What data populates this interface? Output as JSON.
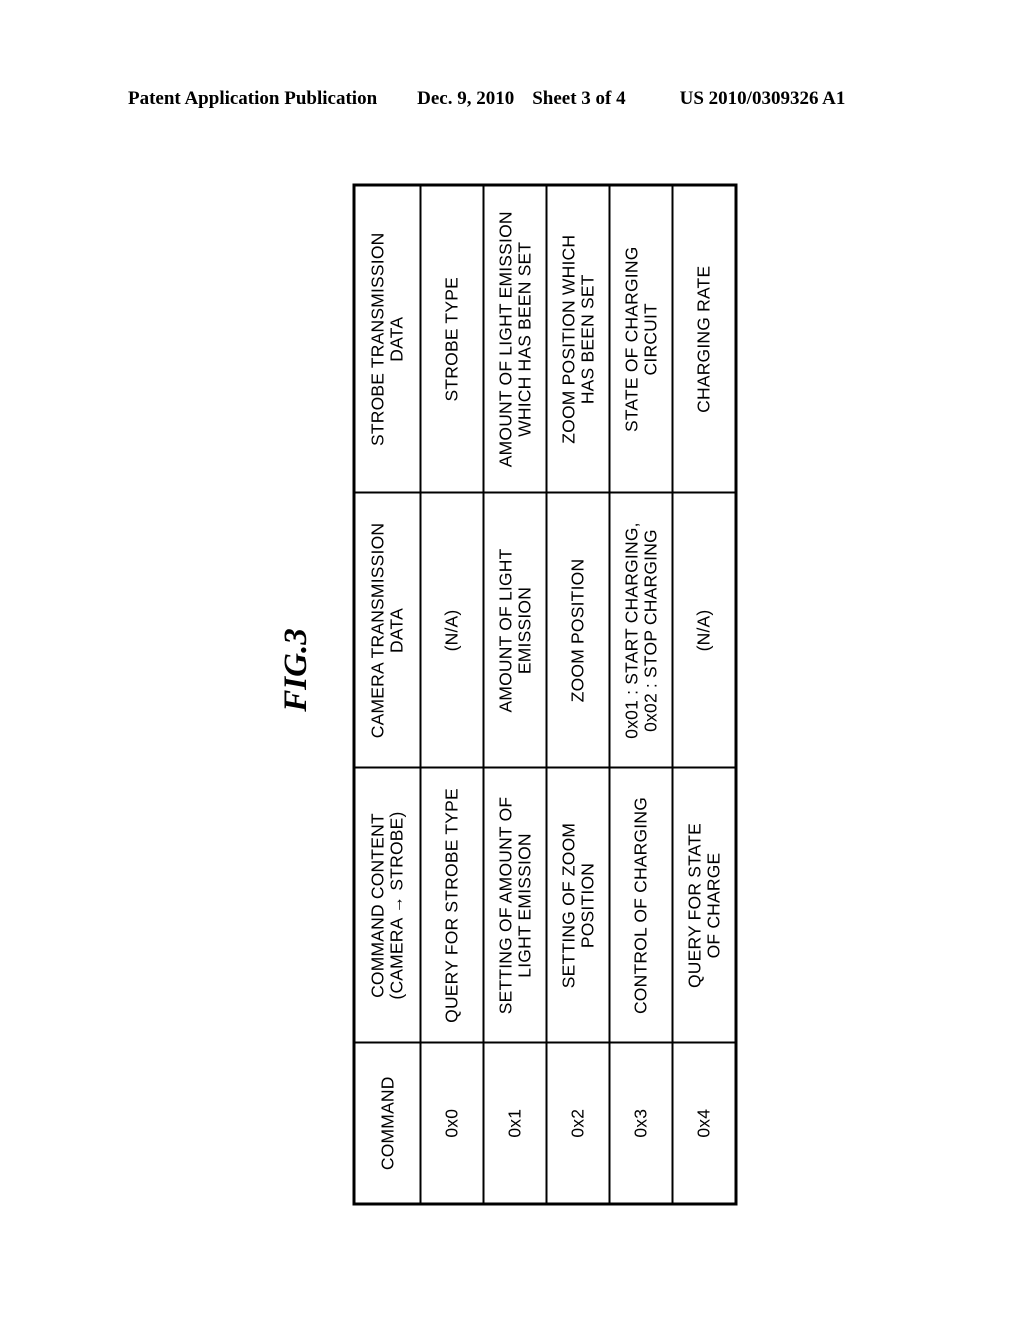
{
  "header": {
    "publication": "Patent Application Publication",
    "date": "Dec. 9, 2010",
    "sheet": "Sheet 3 of 4",
    "patent_number": "US 2010/0309326 A1"
  },
  "figure": {
    "label": "FIG.3"
  },
  "table": {
    "columns": [
      "COMMAND",
      "COMMAND CONTENT\n(CAMERA → STROBE)",
      "CAMERA TRANSMISSION\nDATA",
      "STROBE TRANSMISSION\nDATA"
    ],
    "rows": [
      {
        "command": "0x0",
        "command_content": "QUERY FOR STROBE TYPE",
        "camera_transmission_data": "(N/A)",
        "strobe_transmission_data": "STROBE TYPE"
      },
      {
        "command": "0x1",
        "command_content": "SETTING OF AMOUNT OF\nLIGHT EMISSION",
        "camera_transmission_data": "AMOUNT OF LIGHT\nEMISSION",
        "strobe_transmission_data": "AMOUNT OF LIGHT EMISSION\nWHICH HAS BEEN SET"
      },
      {
        "command": "0x2",
        "command_content": "SETTING OF ZOOM\nPOSITION",
        "camera_transmission_data": "ZOOM POSITION",
        "strobe_transmission_data": "ZOOM POSITION WHICH\nHAS BEEN SET"
      },
      {
        "command": "0x3",
        "command_content": "CONTROL OF CHARGING",
        "camera_transmission_data": "0x01 : START CHARGING,\n0x02 : STOP CHARGING",
        "strobe_transmission_data": "STATE OF CHARGING\nCIRCUIT"
      },
      {
        "command": "0x4",
        "command_content": "QUERY FOR STATE\nOF CHARGE",
        "camera_transmission_data": "(N/A)",
        "strobe_transmission_data": "CHARGING RATE"
      }
    ]
  }
}
